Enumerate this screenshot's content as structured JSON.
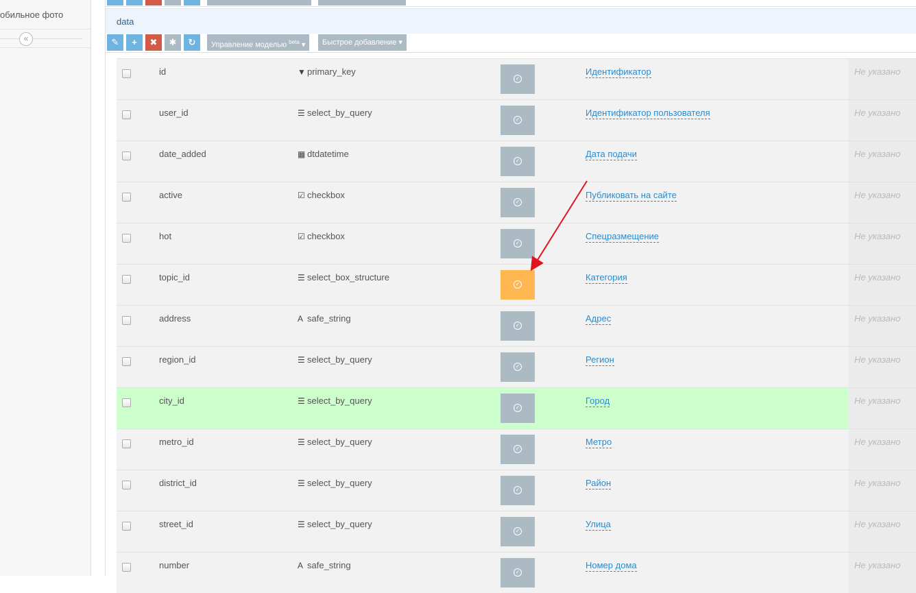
{
  "sidebar": {
    "menu_item": "обильное фото",
    "collapse_glyph": "«"
  },
  "section": {
    "title": "data"
  },
  "toolbar": {
    "edit_icon": "✎",
    "add_icon": "+",
    "delete_icon": "✖",
    "settings_icon": "✱",
    "refresh_icon": "↻",
    "model_manage_label": "Управление моделью",
    "model_manage_badge": "beta",
    "quick_add_label": "Быстрое добавление"
  },
  "fields": [
    {
      "name": "id",
      "type": "primary_key",
      "type_icon": "funnel-icon",
      "type_glyph": "▼",
      "title": "Идентификатор",
      "status": "Не указано",
      "highlight": false,
      "active": false
    },
    {
      "name": "user_id",
      "type": "select_by_query",
      "type_icon": "list-icon",
      "type_glyph": "☰",
      "title": "Идентификатор пользователя",
      "status": "Не указано",
      "highlight": false,
      "active": false
    },
    {
      "name": "date_added",
      "type": "dtdatetime",
      "type_icon": "calendar-icon",
      "type_glyph": "▦",
      "title": "Дата подачи",
      "status": "Не указано",
      "highlight": false,
      "active": false
    },
    {
      "name": "active",
      "type": "checkbox",
      "type_icon": "checkbox-icon",
      "type_glyph": "☑",
      "title": "Публиковать на сайте",
      "status": "Не указано",
      "highlight": false,
      "active": false
    },
    {
      "name": "hot",
      "type": "checkbox",
      "type_icon": "checkbox-icon",
      "type_glyph": "☑",
      "title": "Спецразмещение",
      "status": "Не указано",
      "highlight": false,
      "active": false
    },
    {
      "name": "topic_id",
      "type": "select_box_structure",
      "type_icon": "list-icon",
      "type_glyph": "☰",
      "title": "Категория",
      "status": "Не указано",
      "highlight": false,
      "active": true
    },
    {
      "name": "address",
      "type": "safe_string",
      "type_icon": "font-icon",
      "type_glyph": "A",
      "title": "Адрес",
      "status": "Не указано",
      "highlight": false,
      "active": false
    },
    {
      "name": "region_id",
      "type": "select_by_query",
      "type_icon": "list-icon",
      "type_glyph": "☰",
      "title": "Регион",
      "status": "Не указано",
      "highlight": false,
      "active": false
    },
    {
      "name": "city_id",
      "type": "select_by_query",
      "type_icon": "list-icon",
      "type_glyph": "☰",
      "title": "Город",
      "status": "Не указано",
      "highlight": true,
      "active": false
    },
    {
      "name": "metro_id",
      "type": "select_by_query",
      "type_icon": "list-icon",
      "type_glyph": "☰",
      "title": "Метро",
      "status": "Не указано",
      "highlight": false,
      "active": false
    },
    {
      "name": "district_id",
      "type": "select_by_query",
      "type_icon": "list-icon",
      "type_glyph": "☰",
      "title": "Район",
      "status": "Не указано",
      "highlight": false,
      "active": false
    },
    {
      "name": "street_id",
      "type": "select_by_query",
      "type_icon": "list-icon",
      "type_glyph": "☰",
      "title": "Улица",
      "status": "Не указано",
      "highlight": false,
      "active": false
    },
    {
      "name": "number",
      "type": "safe_string",
      "type_icon": "font-icon",
      "type_glyph": "A",
      "title": "Номер дома",
      "status": "Не указано",
      "highlight": false,
      "active": false
    }
  ],
  "colors": {
    "primary_button": "#6fb3e0",
    "danger_button": "#d15b47",
    "neutral_button": "#abbac3",
    "active_action": "#ffb752",
    "highlight_row": "#ccffcc",
    "link": "#2a8bcc",
    "annotation_arrow": "#e0141c"
  },
  "annotation": {
    "arrow_target": "topic_id"
  }
}
